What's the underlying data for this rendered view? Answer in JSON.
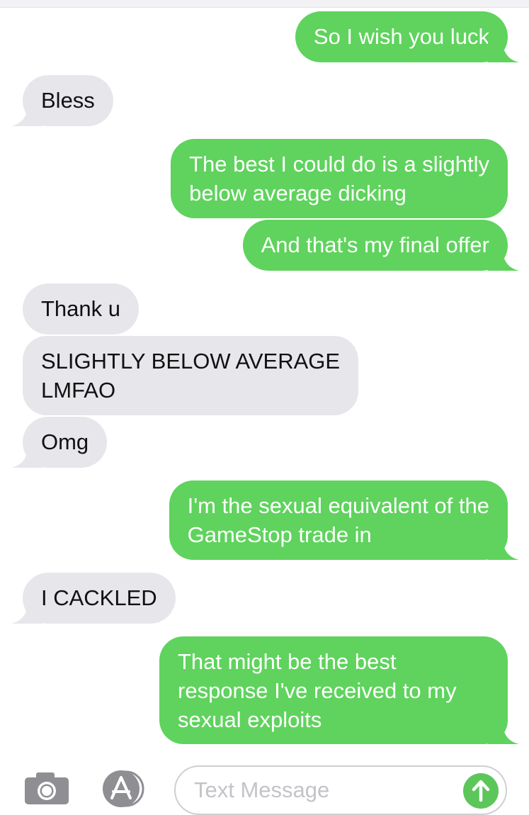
{
  "conversation": {
    "messages": [
      {
        "side": "sent",
        "text": "So I wish you luck"
      },
      {
        "side": "received",
        "text": "Bless"
      },
      {
        "side": "sent",
        "line1": "The best I could do is a slightly",
        "line2": "below average dicking"
      },
      {
        "side": "sent",
        "text": "And that's my final offer"
      },
      {
        "side": "received",
        "text": "Thank u"
      },
      {
        "side": "received",
        "line1": "SLIGHTLY BELOW AVERAGE",
        "line2": "LMFAO"
      },
      {
        "side": "received",
        "text": "Omg"
      },
      {
        "side": "sent",
        "line1": "I'm the sexual equivalent of the",
        "line2": "GameStop trade in"
      },
      {
        "side": "received",
        "text": "I CACKLED"
      },
      {
        "side": "sent",
        "line1": "That might be the best",
        "line2": "response I've received to my",
        "line3": "sexual exploits"
      }
    ]
  },
  "composer": {
    "placeholder": "Text Message",
    "camera_icon": "camera-icon",
    "apps_icon": "app-store-icon",
    "send_icon": "send-arrow-icon"
  },
  "colors": {
    "sent_bubble": "#5fd35d",
    "received_bubble": "#e6e6eb",
    "send_button": "#5cc65a"
  }
}
